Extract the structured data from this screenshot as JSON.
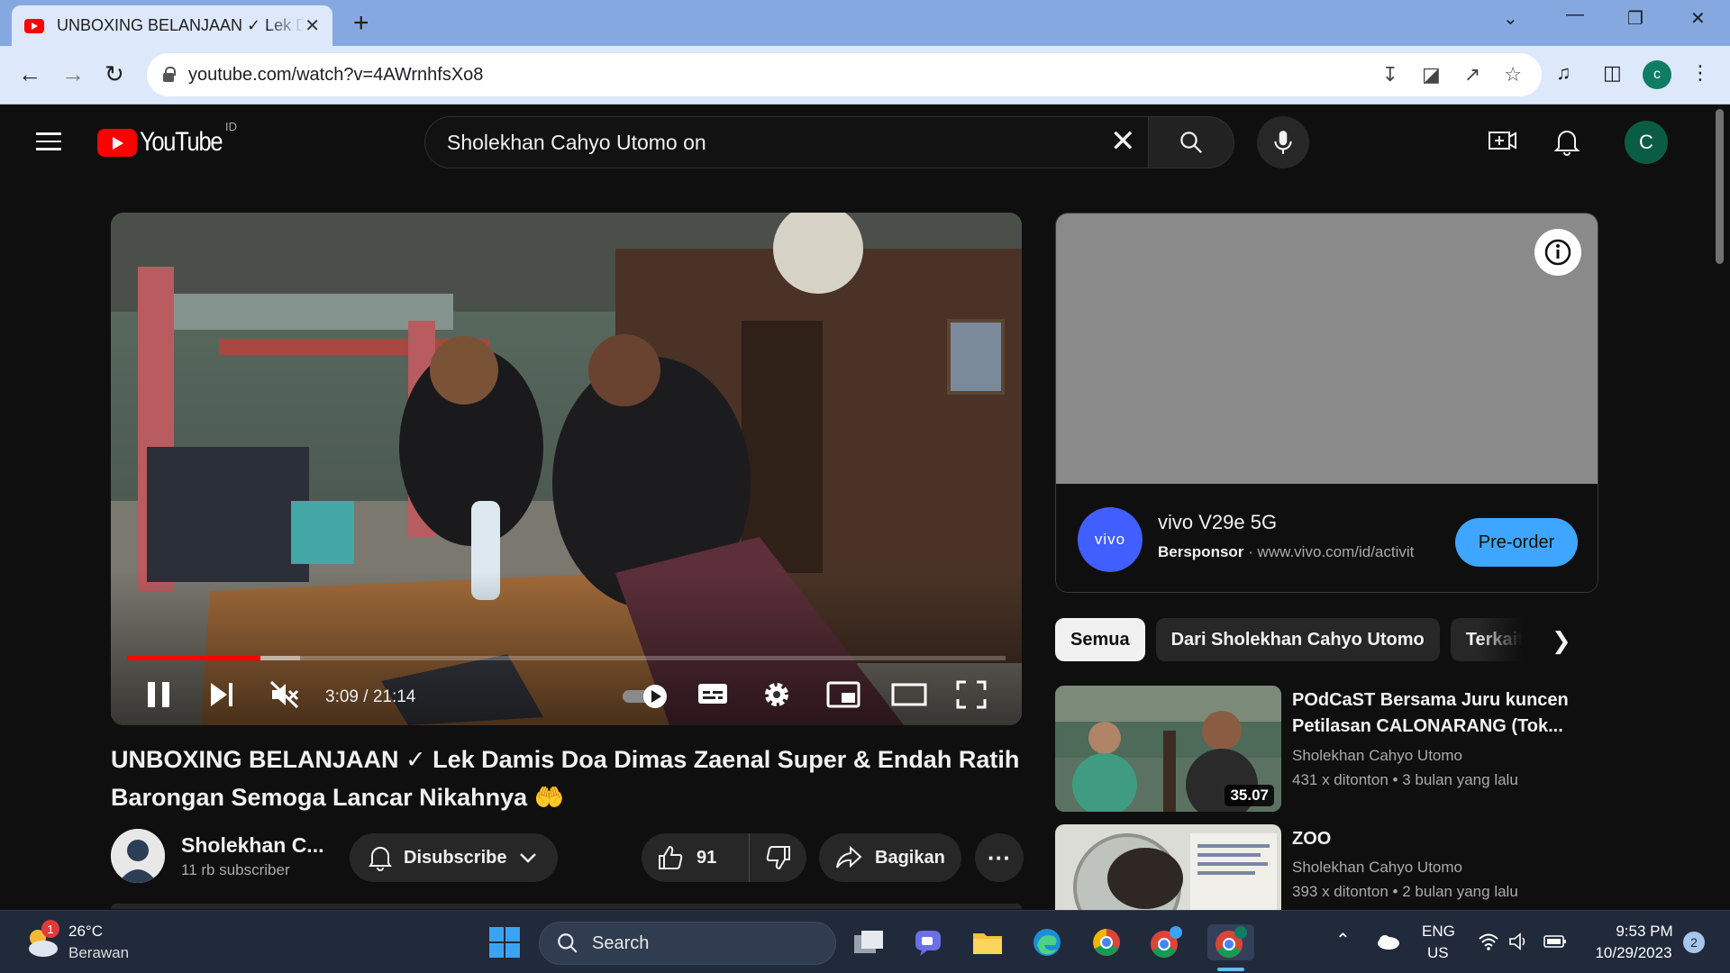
{
  "browser": {
    "tab_title": "UNBOXING BELANJAAN ✓ Lek Damis Doa Dimas Zaenal Super & Endah Ratih",
    "tab_close": "✕",
    "new_tab": "+",
    "url": "youtube.com/watch?v=4AWrnhfsXo8",
    "profile_initial": "c"
  },
  "header": {
    "logo_text": "YouTube",
    "country_code": "ID",
    "search_value": "Sholekhan Cahyo Utomo on",
    "avatar_initial": "C"
  },
  "player": {
    "time": "3:09 / 21:14",
    "played_fraction": 0.152,
    "buffered_fraction": 0.197
  },
  "ad": {
    "logo_text": "vivo",
    "title": "vivo V29e 5G",
    "sponsor_label": "Bersponsor",
    "domain": "www.vivo.com/id/activit",
    "cta": "Pre-order"
  },
  "chips": [
    "Semua",
    "Dari Sholekhan Cahyo Utomo",
    "Terkait"
  ],
  "related": [
    {
      "title": "POdCaST Bersama Juru kuncen Petilasan CALONARANG (Tok...",
      "channel": "Sholekhan Cahyo Utomo",
      "views": "431 x ditonton",
      "age": "3 bulan yang lalu",
      "duration": "35.07"
    },
    {
      "title": "ZOO",
      "channel": "Sholekhan Cahyo Utomo",
      "views": "393 x ditonton",
      "age": "2 bulan yang lalu",
      "duration": ""
    }
  ],
  "video": {
    "title": "UNBOXING BELANJAAN ✓ Lek Damis Doa Dimas Zaenal Super & Endah Ratih Barongan Semoga Lancar Nikahnya 🤲",
    "channel_name": "Sholekhan C...",
    "subscribers": "11 rb subscriber",
    "subscribe_label": "Disubscribe",
    "like_count": "91",
    "share_label": "Bagikan",
    "more_label": "···"
  },
  "taskbar": {
    "weather_temp": "26°C",
    "weather_desc": "Berawan",
    "weather_badge": "1",
    "search_label": "Search",
    "lang_top": "ENG",
    "lang_bottom": "US",
    "time": "9:53 PM",
    "date": "10/29/2023",
    "notif_count": "2"
  },
  "colors": {
    "youtube_red": "#ff0000",
    "cta_blue": "#3ea6ff",
    "vivo_blue": "#415fff"
  }
}
